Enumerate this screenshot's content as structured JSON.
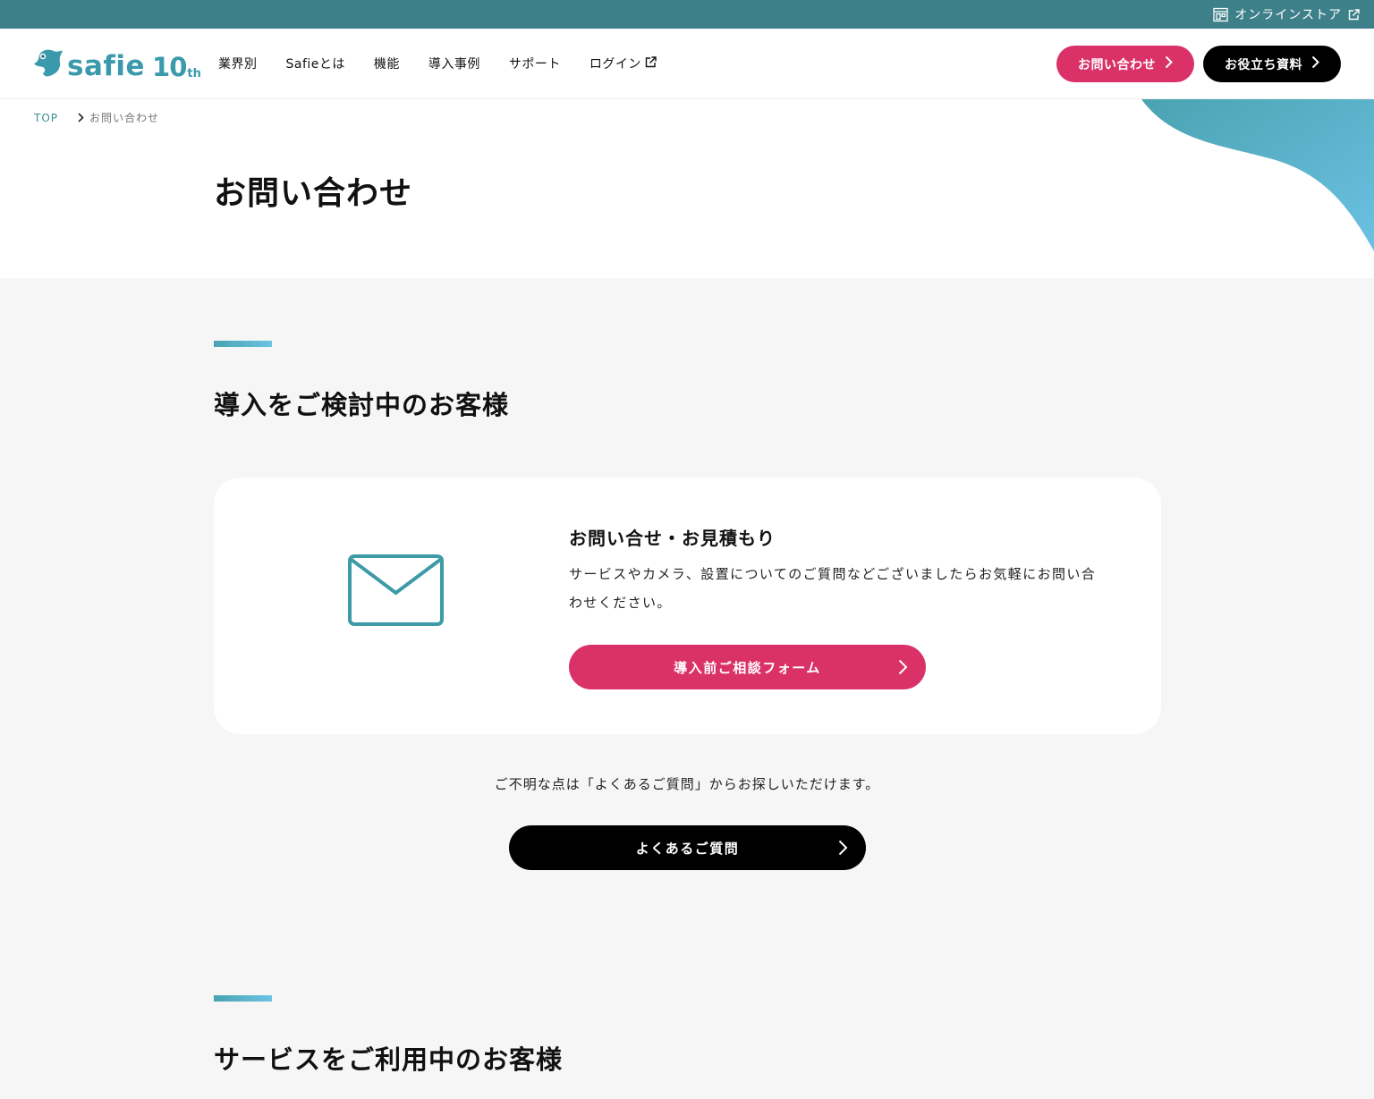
{
  "topbar": {
    "store_label": "オンラインストア"
  },
  "header": {
    "logo_text": "safie",
    "logo_anniversary": "10",
    "logo_anniversary_suffix": "th",
    "nav": [
      {
        "label": "業界別"
      },
      {
        "label": "Safieとは"
      },
      {
        "label": "機能"
      },
      {
        "label": "導入事例"
      },
      {
        "label": "サポート"
      },
      {
        "label": "ログイン"
      }
    ],
    "contact_button": "お問い合わせ",
    "resources_button": "お役立ち資料"
  },
  "breadcrumb": {
    "top": "TOP",
    "current": "お問い合わせ"
  },
  "page_title": "お問い合わせ",
  "section1": {
    "title": "導入をご検討中のお客様",
    "card": {
      "title": "お問い合せ・お見積もり",
      "description": "サービスやカメラ、設置についてのご質問などございましたらお気軽にお問い合わせください。",
      "button": "導入前ご相談フォーム"
    },
    "faq_note": "ご不明な点は「よくあるご質問」からお探しいただけます。",
    "faq_button": "よくあるご質問"
  },
  "section2": {
    "title": "サービスをご利用中のお客様"
  },
  "colors": {
    "topbar": "#3d8089",
    "brand": "#3a9aab",
    "accent_pink": "#da3268",
    "black": "#000000",
    "page_bg": "#f6f6f6"
  },
  "icons": {
    "store": "store-icon",
    "external": "external-link-icon",
    "chevron": "chevron-right-icon",
    "mail": "mail-icon"
  }
}
